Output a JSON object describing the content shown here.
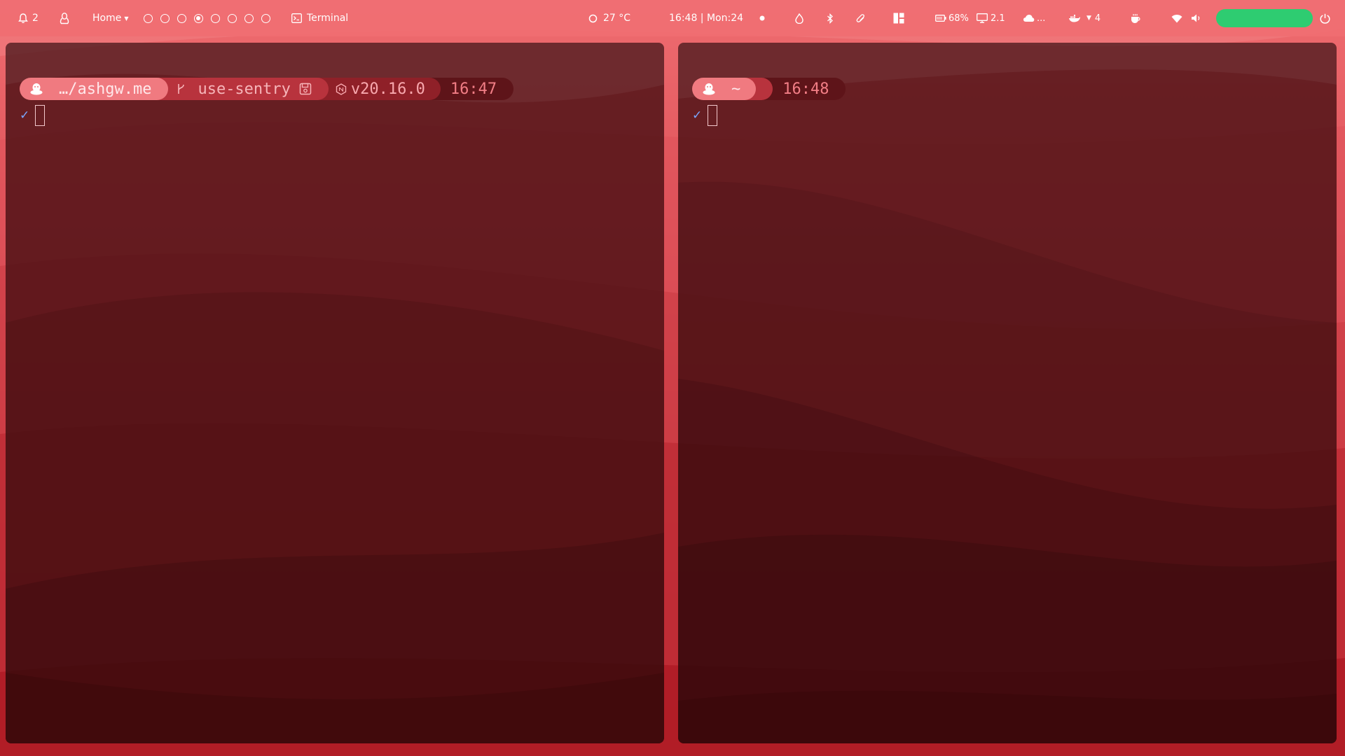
{
  "topbar": {
    "notification_count": "2",
    "home_label": "Home",
    "workspaces": [
      {
        "active": false
      },
      {
        "active": false
      },
      {
        "active": false
      },
      {
        "active": true
      },
      {
        "active": false
      },
      {
        "active": false
      },
      {
        "active": false
      },
      {
        "active": false
      }
    ],
    "active_window": "Terminal",
    "temperature": "27 °C",
    "datetime": "16:48 | Mon:24",
    "battery": "68%",
    "monitor_value": "2.1",
    "cloud_text": "...",
    "docker_count": "4",
    "colors": {
      "bar": "#f06e72",
      "toggle": "#2ecc71"
    },
    "icons": [
      "bell-icon",
      "linux-icon",
      "terminal-icon",
      "weather-icon",
      "record-dot-icon",
      "fire-icon",
      "bluetooth-icon",
      "paperclip-icon",
      "layout-icon",
      "battery-icon",
      "monitor-icon",
      "cloud-icon",
      "docker-icon",
      "caret-down-icon",
      "coffee-icon",
      "wifi-icon",
      "volume-icon",
      "power-icon"
    ]
  },
  "left_pane": {
    "prompt": {
      "path": "…/ashgw.me",
      "git_branch": "use-sentry",
      "node_version": "v20.16.0",
      "time": "16:47"
    },
    "status_mark": "✓"
  },
  "right_pane": {
    "prompt": {
      "path": "~",
      "time": "16:48"
    },
    "status_mark": "✓"
  }
}
